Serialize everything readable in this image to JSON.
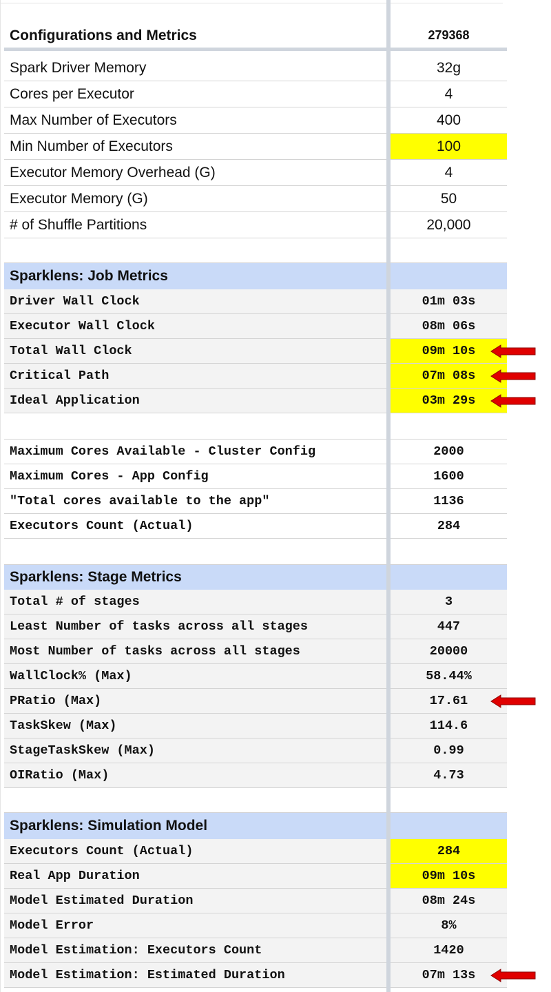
{
  "header": {
    "label": "Configurations and Metrics",
    "value": "279368"
  },
  "config_rows": [
    {
      "label": "Spark Driver Memory",
      "value": "32g",
      "highlight": false
    },
    {
      "label": "Cores per Executor",
      "value": "4",
      "highlight": false
    },
    {
      "label": "Max Number of Executors",
      "value": "400",
      "highlight": false
    },
    {
      "label": "Min Number of Executors",
      "value": "100",
      "highlight": true
    },
    {
      "label": "Executor Memory Overhead (G)",
      "value": "4",
      "highlight": false
    },
    {
      "label": "Executor Memory (G)",
      "value": "50",
      "highlight": false
    },
    {
      "label": "# of Shuffle Partitions",
      "value": "20,000",
      "highlight": false
    }
  ],
  "job_metrics": {
    "title": "Sparklens: Job Metrics",
    "rows": [
      {
        "label": "Driver Wall Clock",
        "value": "01m 03s",
        "highlight": false,
        "arrow": false
      },
      {
        "label": "Executor Wall Clock",
        "value": "08m 06s",
        "highlight": false,
        "arrow": false
      },
      {
        "label": "Total Wall Clock",
        "value": "09m 10s",
        "highlight": true,
        "arrow": true
      },
      {
        "label": "Critical Path",
        "value": "07m 08s",
        "highlight": true,
        "arrow": true
      },
      {
        "label": "Ideal Application",
        "value": "03m 29s",
        "highlight": true,
        "arrow": true
      }
    ],
    "cores_rows": [
      {
        "label": "Maximum Cores Available - Cluster Config",
        "value": "2000"
      },
      {
        "label": "Maximum Cores - App Config",
        "value": "1600"
      },
      {
        "label": "\"Total cores available to the app\"",
        "value": "1136"
      },
      {
        "label": "Executors Count (Actual)",
        "value": "284"
      }
    ]
  },
  "stage_metrics": {
    "title": "Sparklens: Stage Metrics",
    "rows": [
      {
        "label": "Total # of stages",
        "value": "3",
        "arrow": false
      },
      {
        "label": "Least Number of tasks across all stages",
        "value": "447",
        "arrow": false
      },
      {
        "label": "Most Number of tasks across all stages",
        "value": "20000",
        "arrow": false
      },
      {
        "label": "WallClock% (Max)",
        "value": "58.44%",
        "arrow": false
      },
      {
        "label": "PRatio (Max)",
        "value": "17.61",
        "arrow": true
      },
      {
        "label": "TaskSkew (Max)",
        "value": "114.6",
        "arrow": false
      },
      {
        "label": "StageTaskSkew (Max)",
        "value": "0.99",
        "arrow": false
      },
      {
        "label": "OIRatio (Max)",
        "value": "4.73",
        "arrow": false
      }
    ]
  },
  "simulation_model": {
    "title": "Sparklens: Simulation Model",
    "rows": [
      {
        "label": "Executors Count (Actual)",
        "value": "284",
        "highlight": true,
        "arrow": false
      },
      {
        "label": "Real App Duration",
        "value": "09m 10s",
        "highlight": true,
        "arrow": false
      },
      {
        "label": "Model Estimated Duration",
        "value": "08m 24s",
        "highlight": false,
        "arrow": false
      },
      {
        "label": "Model Error",
        "value": "8%",
        "highlight": false,
        "arrow": false
      },
      {
        "label": "Model Estimation: Executors Count",
        "value": "1420",
        "highlight": false,
        "arrow": false
      },
      {
        "label": "Model Estimation: Estimated Duration",
        "value": "07m 13s",
        "highlight": false,
        "arrow": true
      }
    ]
  },
  "colors": {
    "highlight": "#ffff00",
    "section_header": "#c9daf8",
    "arrow": "#e00000",
    "grey_row": "#f3f3f3"
  }
}
